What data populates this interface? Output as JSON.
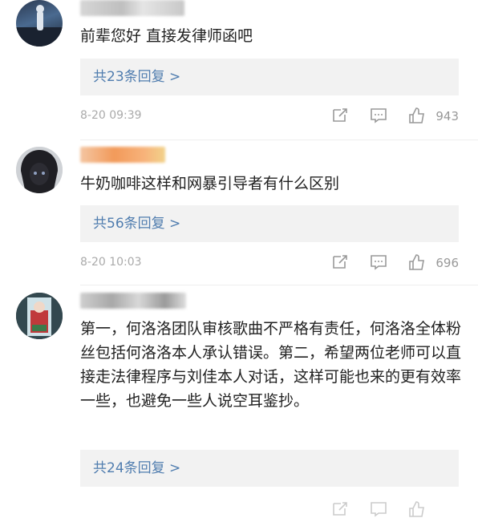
{
  "comments": [
    {
      "text": "前辈您好 直接发律师函吧",
      "replies_label": "共23条回复 >",
      "time": "8-20 09:39",
      "likes": "943"
    },
    {
      "text": "牛奶咖啡这样和网暴引导者有什么区别",
      "replies_label": "共56条回复 >",
      "time": "8-20 10:03",
      "likes": "696"
    },
    {
      "text": "第一，何洛洛团队审核歌曲不严格有责任，何洛洛全体粉丝包括何洛洛本人承认错误。第二，希望两位老师可以直接走法律程序与刘佳本人对话，这样可能也来的更有效率一些，也避免一些人说空耳鉴抄。",
      "replies_label": "共24条回复 >",
      "time": "",
      "likes": ""
    }
  ],
  "icons": {
    "share": "share-icon",
    "comment": "comment-icon",
    "like": "thumbs-up-icon"
  },
  "colors": {
    "link": "#507daf",
    "reply_bg": "#f2f2f2",
    "meta": "#aaaaaa"
  }
}
